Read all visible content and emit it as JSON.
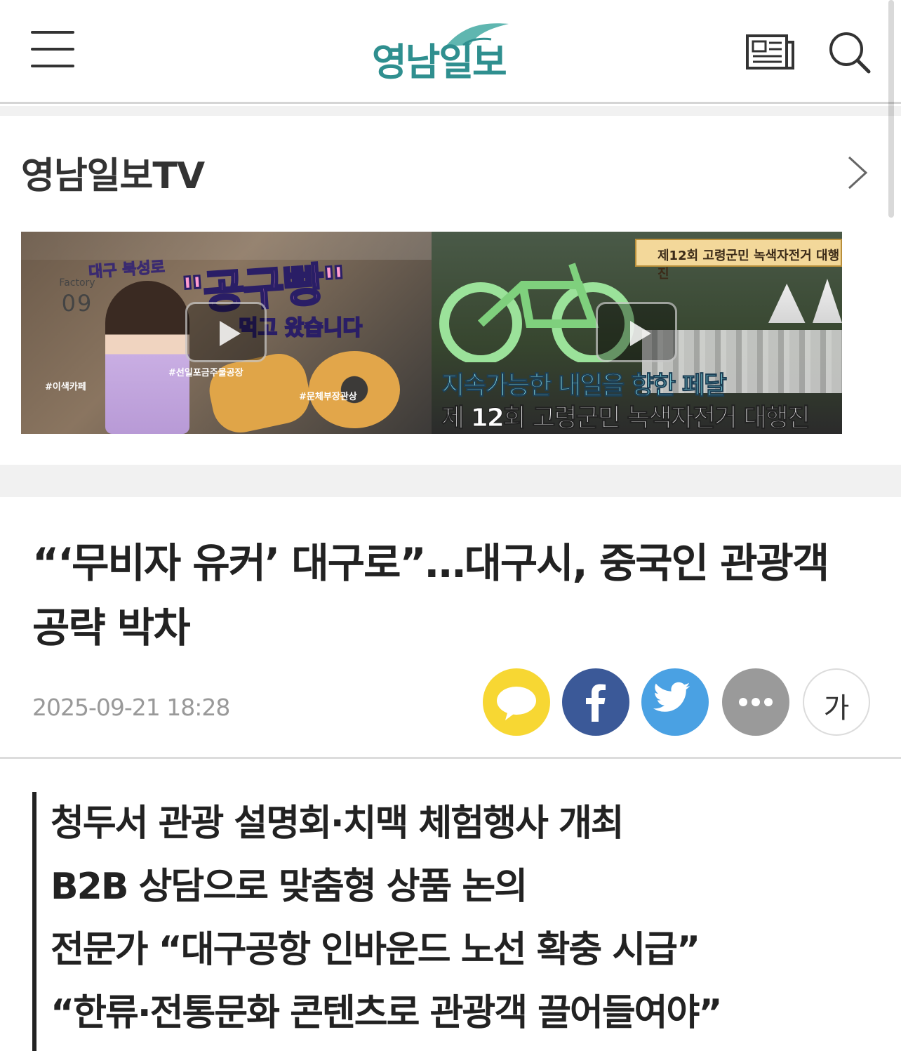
{
  "header": {
    "logo_text": "영남일보",
    "icons": [
      "menu-icon",
      "newspaper-icon",
      "search-icon"
    ],
    "brand_color": "#2f8f8f"
  },
  "tv": {
    "title": "영남일보TV",
    "more_icon": "chevron-right-icon",
    "videos": [
      {
        "tag": "대구 북성로",
        "main": "\"공구빵\"",
        "sub": "먹고 왔습니다",
        "factory_label": "Factory",
        "factory_num": "09",
        "hashtags": [
          "#이색카페",
          "#선일포금주물공장",
          "#문체부장관상"
        ]
      },
      {
        "banner": "제12회 고령군민 녹색자전거 대행진",
        "line1": "지속가능한 내일을 향한 페달",
        "line2": "제 12회 고령군민 녹색자전거 대행진"
      }
    ]
  },
  "article": {
    "headline": "“‘무비자 유커’ 대구로”…대구시, 중국인 관광객 공략 박차",
    "date": "2025-09-21 18:28",
    "font_button_label": "가",
    "share_colors": {
      "kakao": "#f7d733",
      "facebook": "#3b5998",
      "twitter": "#4aa1e3",
      "more": "#9a9a9a"
    },
    "summary": [
      "청두서 관광 설명회·치맥 체험행사 개최",
      "B2B 상담으로 맞춤형 상품 논의",
      "전문가 “대구공항 인바운드 노선 확충 시급”",
      "“한류·전통문화 콘텐츠로 관광객 끌어들여야”"
    ]
  }
}
